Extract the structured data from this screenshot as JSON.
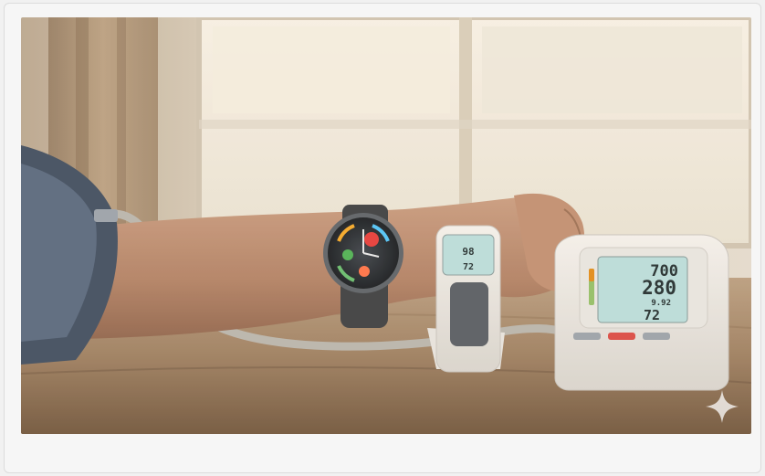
{
  "photo": {
    "devices": [
      "smartwatch",
      "pulse-oximeter",
      "blood-pressure-monitor"
    ],
    "oximeter": {
      "line1": "98",
      "line2": "72"
    },
    "monitor": {
      "line1": "700",
      "line2": "280",
      "line3": "9.92",
      "line4": "72"
    },
    "watermark_icon": "sparkle-icon"
  },
  "colors": {
    "page_bg": "#f6f6f6",
    "table": "#9a7a5c",
    "wall": "#d8cbb8",
    "lcd": "#b9dcd8"
  }
}
